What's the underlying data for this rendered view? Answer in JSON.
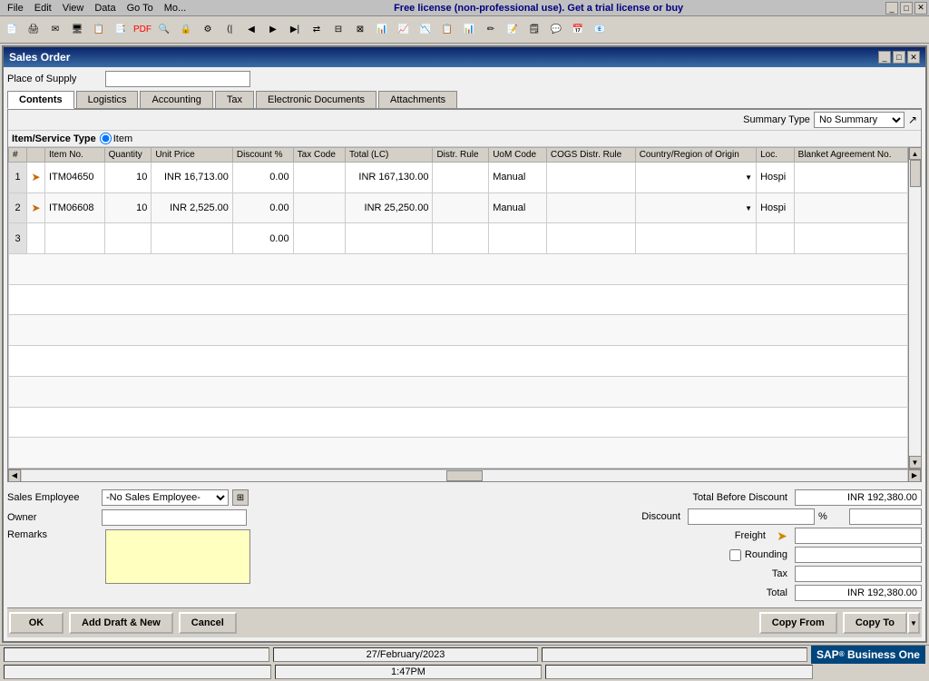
{
  "titleBar": {
    "text": "Free license (non-professional use). Get a trial license or buy"
  },
  "window": {
    "title": "Sales Order"
  },
  "placeOfSupply": {
    "label": "Place of Supply",
    "value": ""
  },
  "tabs": [
    {
      "label": "Contents",
      "active": true
    },
    {
      "label": "Logistics",
      "active": false
    },
    {
      "label": "Accounting",
      "active": false
    },
    {
      "label": "Tax",
      "active": false
    },
    {
      "label": "Electronic Documents",
      "active": false
    },
    {
      "label": "Attachments",
      "active": false
    }
  ],
  "summaryType": {
    "label": "Summary Type",
    "value": "No Summary"
  },
  "itemServiceType": {
    "label": "Item/Service Type",
    "selected": "Item"
  },
  "tableHeaders": [
    "#",
    "",
    "Item No.",
    "Quantity",
    "Unit Price",
    "Discount %",
    "Tax Code",
    "Total (LC)",
    "Distr. Rule",
    "UoM Code",
    "COGS Distr. Rule",
    "Country/Region of Origin",
    "Loc.",
    "Blanket Agreement No."
  ],
  "tableRows": [
    {
      "num": "1",
      "itemNo": "ITM04650",
      "quantity": "10",
      "unitPrice": "INR 16,713.00",
      "discount": "0.00",
      "taxCode": "",
      "total": "INR 167,130.00",
      "distrRule": "",
      "uomCode": "Manual",
      "cogsDistr": "",
      "country": "",
      "loc": "Hospi",
      "blanket": ""
    },
    {
      "num": "2",
      "itemNo": "ITM06608",
      "quantity": "10",
      "unitPrice": "INR 2,525.00",
      "discount": "0.00",
      "taxCode": "",
      "total": "INR 25,250.00",
      "distrRule": "",
      "uomCode": "Manual",
      "cogsDistr": "",
      "country": "",
      "loc": "Hospi",
      "blanket": ""
    },
    {
      "num": "3",
      "itemNo": "",
      "quantity": "",
      "unitPrice": "",
      "discount": "0.00",
      "taxCode": "",
      "total": "",
      "distrRule": "",
      "uomCode": "",
      "cogsDistr": "",
      "country": "",
      "loc": "",
      "blanket": ""
    }
  ],
  "bottomForm": {
    "salesEmployee": {
      "label": "Sales Employee",
      "value": "-No Sales Employee-"
    },
    "owner": {
      "label": "Owner",
      "value": ""
    },
    "remarks": {
      "label": "Remarks",
      "value": ""
    }
  },
  "summary": {
    "totalBeforeDiscount": {
      "label": "Total Before Discount",
      "value": "INR 192,380.00"
    },
    "discount": {
      "label": "Discount",
      "value": "",
      "pct": "%"
    },
    "freight": {
      "label": "Freight",
      "value": ""
    },
    "rounding": {
      "label": "Rounding",
      "value": ""
    },
    "tax": {
      "label": "Tax",
      "value": ""
    },
    "total": {
      "label": "Total",
      "value": "INR 192,380.00"
    }
  },
  "buttons": {
    "ok": "OK",
    "addDraftNew": "Add Draft & New",
    "cancel": "Cancel",
    "copyFrom": "Copy From",
    "copyTo": "Copy To"
  },
  "statusBar": {
    "date": "27/February/2023",
    "time": "1:47PM"
  }
}
